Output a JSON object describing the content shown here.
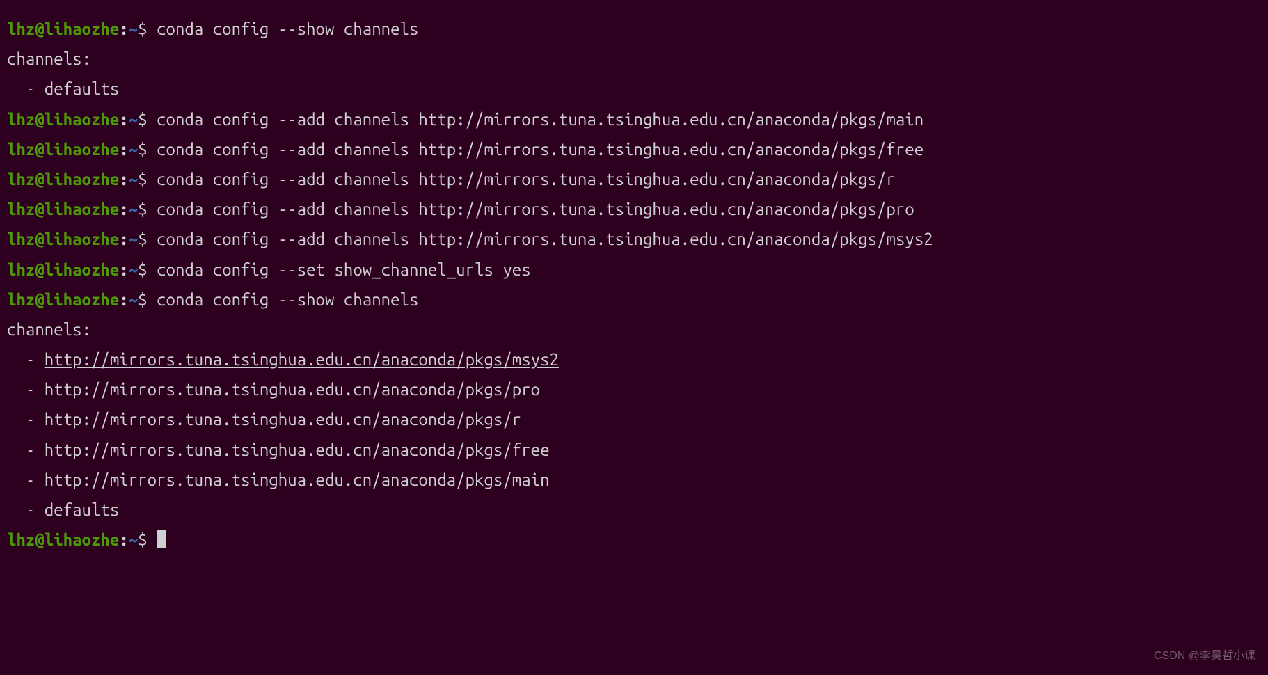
{
  "prompt": {
    "user_host": "lhz@lihaozhe",
    "path": "~",
    "symbol": "$"
  },
  "lines": [
    {
      "type": "prompt",
      "cmd": "conda config --show channels"
    },
    {
      "type": "output",
      "text": "channels:"
    },
    {
      "type": "output",
      "text": "  - defaults"
    },
    {
      "type": "prompt",
      "cmd": "conda config --add channels http://mirrors.tuna.tsinghua.edu.cn/anaconda/pkgs/main"
    },
    {
      "type": "prompt",
      "cmd": "conda config --add channels http://mirrors.tuna.tsinghua.edu.cn/anaconda/pkgs/free"
    },
    {
      "type": "prompt",
      "cmd": "conda config --add channels http://mirrors.tuna.tsinghua.edu.cn/anaconda/pkgs/r"
    },
    {
      "type": "prompt",
      "cmd": "conda config --add channels http://mirrors.tuna.tsinghua.edu.cn/anaconda/pkgs/pro"
    },
    {
      "type": "prompt",
      "cmd": "conda config --add channels http://mirrors.tuna.tsinghua.edu.cn/anaconda/pkgs/msys2"
    },
    {
      "type": "prompt",
      "cmd": "conda config --set show_channel_urls yes"
    },
    {
      "type": "prompt",
      "cmd": "conda config --show channels"
    },
    {
      "type": "output",
      "text": "channels:"
    },
    {
      "type": "list-underlined",
      "prefix": "  - ",
      "text": "http://mirrors.tuna.tsinghua.edu.cn/anaconda/pkgs/msys2"
    },
    {
      "type": "output",
      "text": "  - http://mirrors.tuna.tsinghua.edu.cn/anaconda/pkgs/pro"
    },
    {
      "type": "output",
      "text": "  - http://mirrors.tuna.tsinghua.edu.cn/anaconda/pkgs/r"
    },
    {
      "type": "output",
      "text": "  - http://mirrors.tuna.tsinghua.edu.cn/anaconda/pkgs/free"
    },
    {
      "type": "output",
      "text": "  - http://mirrors.tuna.tsinghua.edu.cn/anaconda/pkgs/main"
    },
    {
      "type": "output",
      "text": "  - defaults"
    },
    {
      "type": "prompt-cursor",
      "cmd": ""
    }
  ],
  "watermark": "CSDN @李昊哲小课"
}
